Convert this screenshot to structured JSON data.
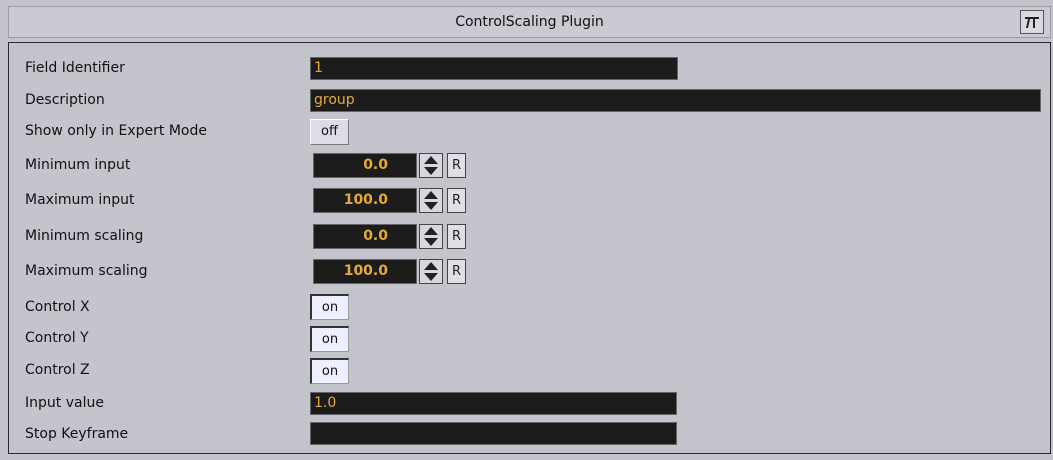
{
  "window": {
    "title": "ControlScaling Plugin",
    "logo_icon": "vizrt-logo-icon"
  },
  "fields": {
    "field_identifier": {
      "label": "Field Identifier",
      "value": "1"
    },
    "description": {
      "label": "Description",
      "value": "group"
    },
    "expert_mode": {
      "label": "Show only in Expert Mode",
      "value": "off"
    },
    "min_input": {
      "label": "Minimum input",
      "value": "0.0"
    },
    "max_input": {
      "label": "Maximum input",
      "value": "100.0"
    },
    "min_scaling": {
      "label": "Minimum scaling",
      "value": "0.0"
    },
    "max_scaling": {
      "label": "Maximum scaling",
      "value": "100.0"
    },
    "control_x": {
      "label": "Control X",
      "value": "on"
    },
    "control_y": {
      "label": "Control Y",
      "value": "on"
    },
    "control_z": {
      "label": "Control Z",
      "value": "on"
    },
    "input_value": {
      "label": "Input value",
      "value": "1.0"
    },
    "stop_keyframe": {
      "label": "Stop Keyframe",
      "value": ""
    }
  },
  "reset_label": "R",
  "colors": {
    "field_bg": "#1c1c1c",
    "field_text": "#e9a83a",
    "panel_bg": "#c3c4cc"
  }
}
